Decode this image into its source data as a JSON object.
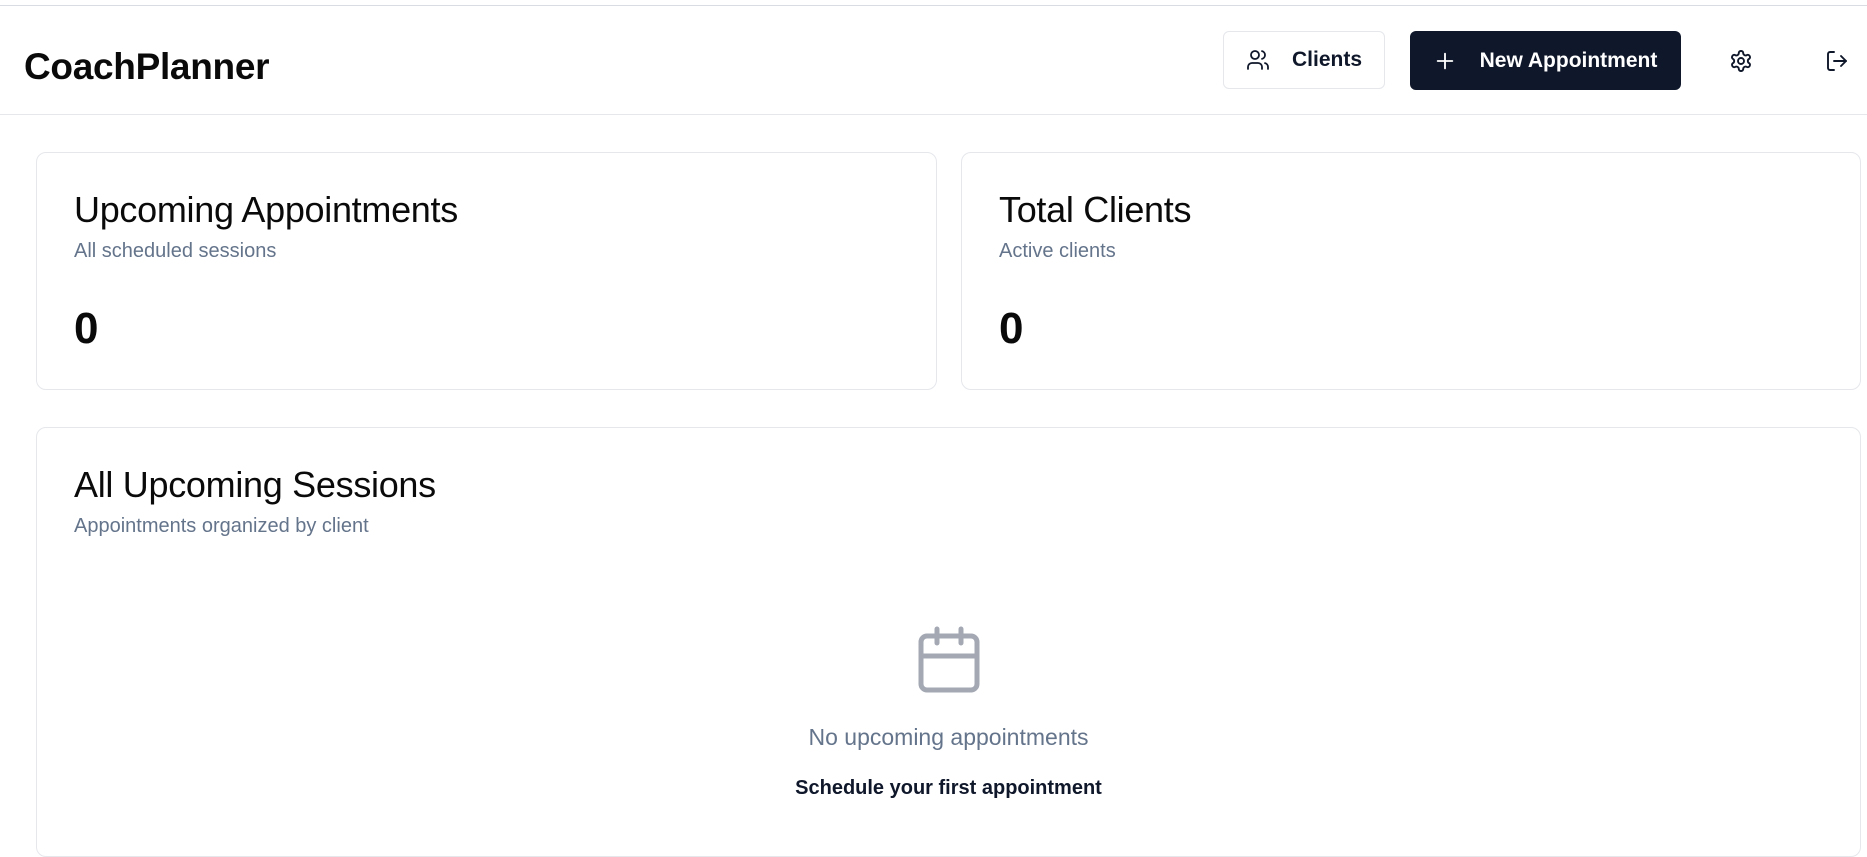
{
  "header": {
    "brand": "CoachPlanner",
    "clients_label": "Clients",
    "new_appointment_label": "New Appointment",
    "icons": [
      "users-icon",
      "plus-icon",
      "settings-icon",
      "logout-icon"
    ]
  },
  "stats": {
    "upcoming": {
      "title": "Upcoming Appointments",
      "subtitle": "All scheduled sessions",
      "value": "0"
    },
    "clients": {
      "title": "Total Clients",
      "subtitle": "Active clients",
      "value": "0"
    }
  },
  "sessions": {
    "title": "All Upcoming Sessions",
    "subtitle": "Appointments organized by client",
    "empty_title": "No upcoming appointments",
    "empty_action": "Schedule your first appointment"
  },
  "colors": {
    "primary": "#0f172a",
    "muted": "#64748b",
    "border": "#e5e7eb",
    "icon_muted": "#a3a8b3"
  }
}
